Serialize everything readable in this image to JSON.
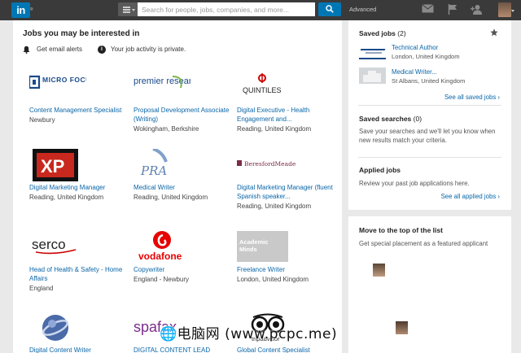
{
  "topbar": {
    "logo": "in",
    "search_placeholder": "Search for people, jobs, companies, and more...",
    "advanced": "Advanced",
    "icons": [
      "menu-icon",
      "search-icon",
      "mail-icon",
      "flag-icon",
      "add-connection-icon",
      "avatar"
    ]
  },
  "jobs": {
    "title": "Jobs you may be interested in",
    "email_alerts": "Get email alerts",
    "privacy_note": "Your job activity is private.",
    "items": [
      {
        "company": "MICRO FOCUS",
        "title": "Content Management Specialist",
        "location": "Newbury"
      },
      {
        "company": "premier research",
        "title": "Proposal Development Associate (Writing)",
        "location": "Wokingham, Berkshire"
      },
      {
        "company": "QUINTILES",
        "title": "Digital Executive - Health Engagement and...",
        "location": "Reading, United Kingdom"
      },
      {
        "company": "XP",
        "title": "Digital Marketing Manager",
        "location": "Reading, United Kingdom"
      },
      {
        "company": "PRA",
        "title": "Medical Writer",
        "location": "Reading, United Kingdom"
      },
      {
        "company": "BeresfordMeade",
        "title": "Digital Marketing Manager (fluent Spanish speaker...",
        "location": "Reading, United Kingdom"
      },
      {
        "company": "serco",
        "title": "Head of Health & Safety - Home Affairs",
        "location": "England"
      },
      {
        "company": "vodafone",
        "title": "Copywriter",
        "location": "England - Newbury"
      },
      {
        "company": "Academic Minds",
        "title": "Freelance Writer",
        "location": "London, United Kingdom"
      },
      {
        "company": "",
        "title": "Digital Content Writer",
        "location": ""
      },
      {
        "company": "spafax",
        "title": "DIGITAL CONTENT LEAD",
        "location": ""
      },
      {
        "company": "tripadvisor",
        "title": "Global Content Specialist",
        "location": ""
      }
    ]
  },
  "saved_jobs": {
    "heading": "Saved jobs",
    "count": "(2)",
    "items": [
      {
        "title": "Technical Author",
        "location": "London, United Kingdom"
      },
      {
        "title": "Medical Writer...",
        "location": "St Albans, United Kingdom"
      }
    ],
    "see_all": "See all saved jobs ›"
  },
  "saved_searches": {
    "heading": "Saved searches",
    "count": "(0)",
    "text": "Save your searches and we'll let you know when new results match your criteria."
  },
  "applied_jobs": {
    "heading": "Applied jobs",
    "text": "Review your past job applications here.",
    "see_all": "See all applied jobs ›"
  },
  "featured": {
    "heading": "Move to the top of the list",
    "text": "Get special placement as a featured applicant"
  },
  "watermark": "🌐电脑网 (www.pcpc.me)",
  "colors": {
    "link": "#0a66a8",
    "topbar": "#3a3a3a",
    "brand": "#0077b5"
  }
}
